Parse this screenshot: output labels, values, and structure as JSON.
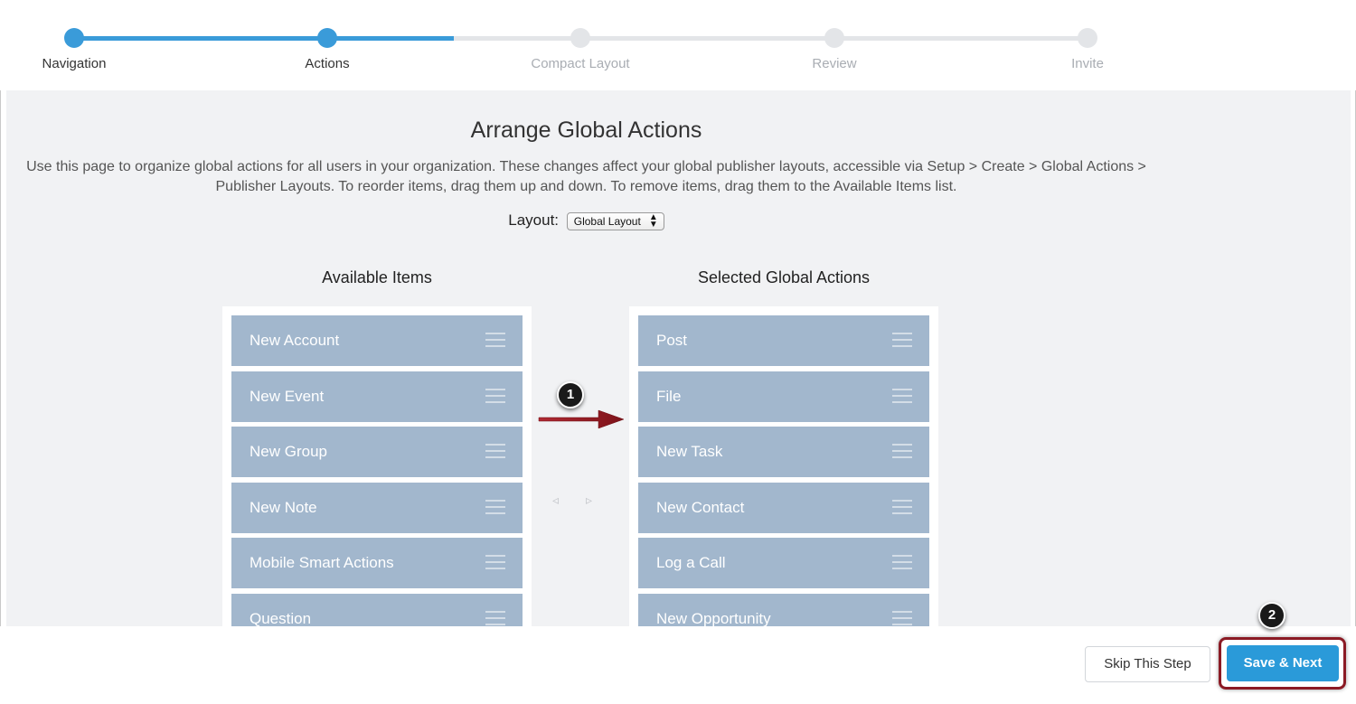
{
  "stepper": {
    "steps": [
      {
        "label": "Navigation",
        "state": "complete"
      },
      {
        "label": "Actions",
        "state": "current"
      },
      {
        "label": "Compact Layout",
        "state": "pending"
      },
      {
        "label": "Review",
        "state": "pending"
      },
      {
        "label": "Invite",
        "state": "pending"
      }
    ],
    "active_color": "#3a9bd9"
  },
  "main": {
    "title": "Arrange Global Actions",
    "description": "Use this page to organize global actions for all users in your organization. These changes affect your global publisher layouts, accessible via Setup > Create > Global Actions > Publisher Layouts. To reorder items, drag them up and down. To remove items, drag them to the Available Items list.",
    "layout_label": "Layout:",
    "layout_select_value": "Global Layout"
  },
  "available": {
    "heading": "Available Items",
    "items": [
      "New Account",
      "New Event",
      "New Group",
      "New Note",
      "Mobile Smart Actions",
      "Question"
    ]
  },
  "selected": {
    "heading": "Selected Global Actions",
    "items": [
      "Post",
      "File",
      "New Task",
      "New Contact",
      "Log a Call",
      "New Opportunity"
    ]
  },
  "move_controls": {
    "left_icon": "triangle-left-icon",
    "right_icon": "triangle-right-icon",
    "left_glyph": "◃",
    "right_glyph": "▹"
  },
  "annotations": {
    "badge_1": "1",
    "badge_2": "2",
    "arrow_color": "#8b1a24"
  },
  "footer": {
    "skip_label": "Skip This Step",
    "save_label": "Save & Next",
    "save_color": "#2a9ad9"
  }
}
